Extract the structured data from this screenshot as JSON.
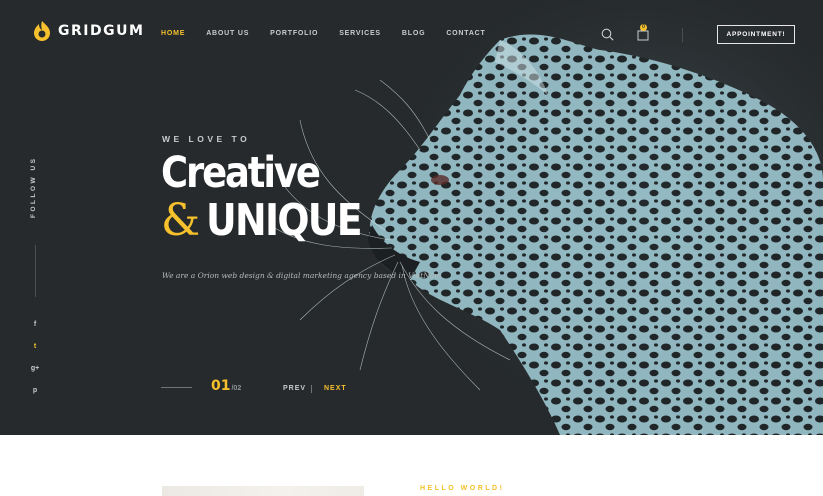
{
  "brand": {
    "name": "GRIDGUM",
    "accent_color": "#f6c12c",
    "bg_color": "#262a2c"
  },
  "nav": {
    "items": [
      {
        "label": "HOME",
        "active": true
      },
      {
        "label": "ABOUT US",
        "active": false
      },
      {
        "label": "PORTFOLIO",
        "active": false
      },
      {
        "label": "SERVICES",
        "active": false
      },
      {
        "label": "BLOG",
        "active": false
      },
      {
        "label": "CONTACT",
        "active": false
      }
    ]
  },
  "header": {
    "search_icon": "search-icon",
    "cart_icon": "shopping-bag-icon",
    "cart_count": "0",
    "appointment_label": "APPOINTMENT!"
  },
  "sidebar": {
    "follow_label": "FOLLOW US",
    "social": [
      {
        "icon": "facebook-icon",
        "glyph": "f"
      },
      {
        "icon": "twitter-icon",
        "glyph": "t"
      },
      {
        "icon": "google-plus-icon",
        "glyph": "g+"
      },
      {
        "icon": "pinterest-icon",
        "glyph": "p"
      }
    ]
  },
  "hero": {
    "eyebrow": "WE LOVE TO",
    "line1": "Creative",
    "ampersand": "&",
    "line2": "UNIQUE",
    "tagline": "We are a Orion web design & digital marketing agency based in VietNam"
  },
  "slider": {
    "current": "01",
    "total": "/02",
    "prev_label": "PREV",
    "next_label": "NEXT"
  },
  "lower": {
    "hello_label": "HELLO WORLD!"
  }
}
